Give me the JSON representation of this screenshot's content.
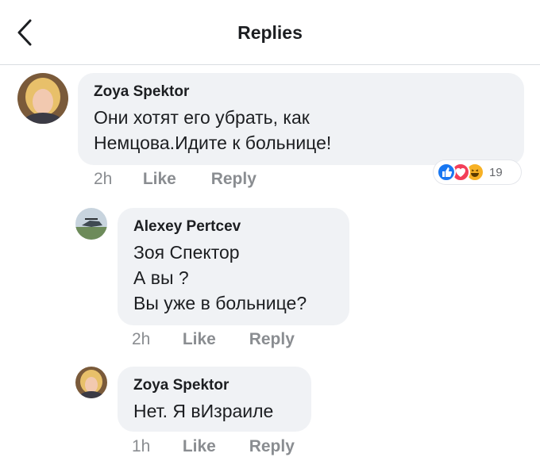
{
  "header": {
    "title": "Replies"
  },
  "comments": [
    {
      "author": "Zoya Spektor",
      "lines": [
        "Они хотят его убрать, как",
        "Немцова.Идите к больнице!"
      ],
      "time": "2h",
      "like": "Like",
      "reply": "Reply",
      "reaction_count": "19",
      "reactions": [
        "like-icon",
        "love-icon",
        "haha-icon"
      ]
    },
    {
      "author": "Alexey Pertcev",
      "lines": [
        "Зоя Спектор",
        "А вы ?",
        "Вы уже в больнице?"
      ],
      "time": "2h",
      "like": "Like",
      "reply": "Reply"
    },
    {
      "author": "Zoya Spektor",
      "lines": [
        "Нет. Я вИзраиле"
      ],
      "time": "1h",
      "like": "Like",
      "reply": "Reply"
    }
  ],
  "colors": {
    "bubble": "#f0f2f5",
    "text": "#1c1e21",
    "meta": "#8a8d91",
    "like_blue": "#1877f2",
    "love_red": "#f33e58",
    "haha_yellow": "#f7b125"
  }
}
